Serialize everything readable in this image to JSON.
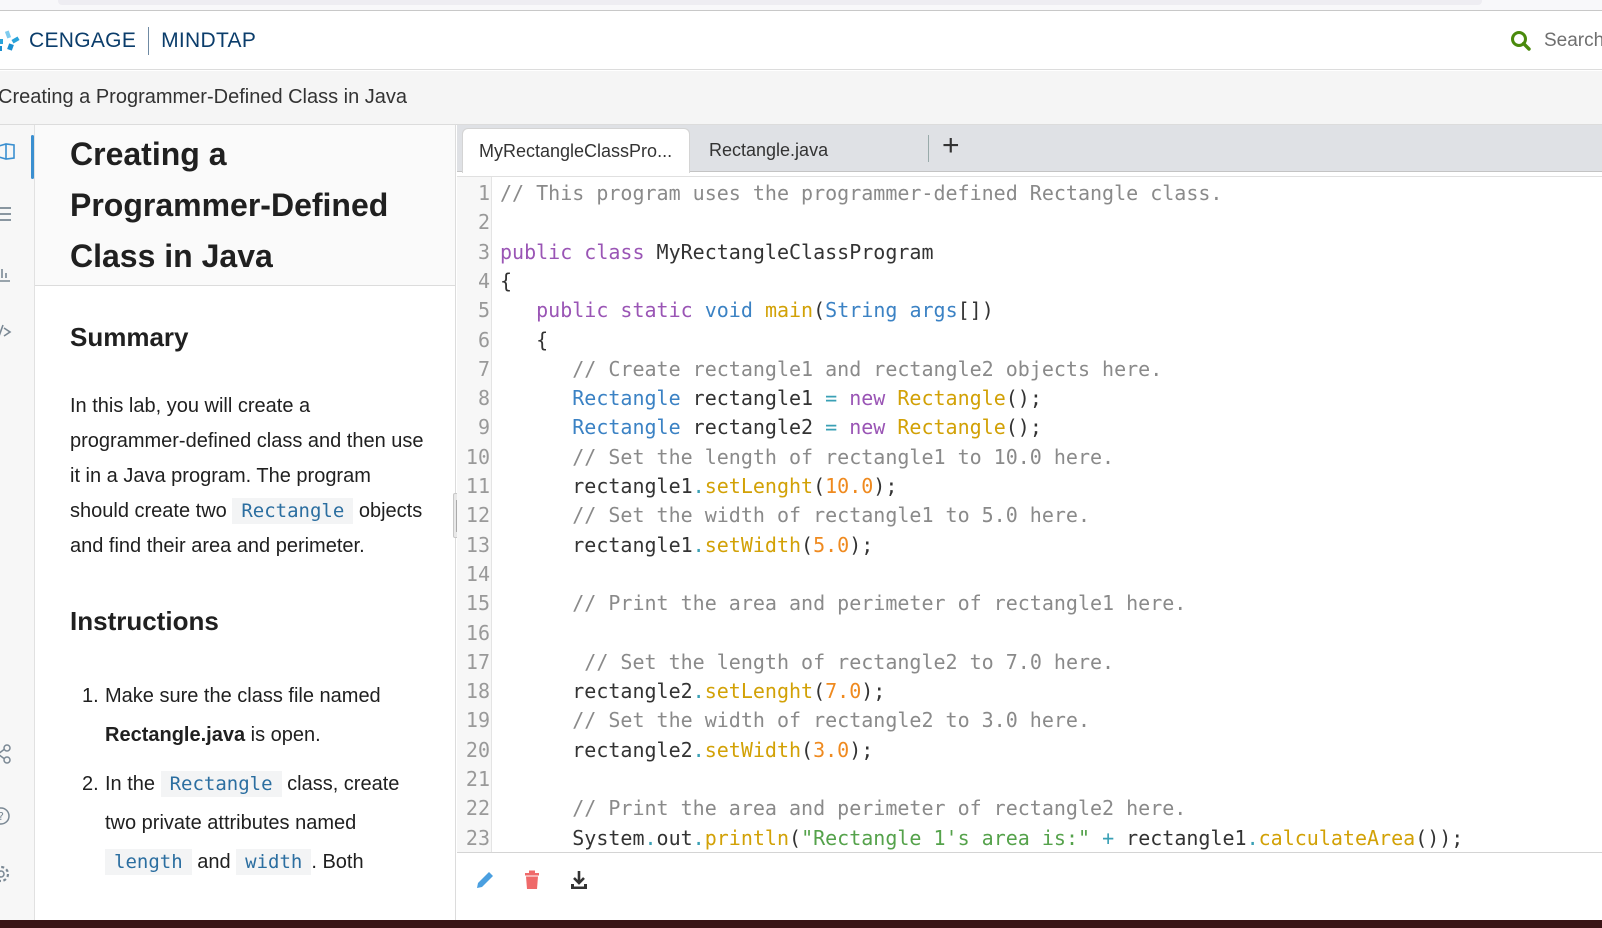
{
  "header": {
    "brand_primary": "CENGAGE",
    "brand_secondary": "MINDTAP",
    "search_label": "Search",
    "search_icon": "search-icon",
    "accent_color": "#4a8a0c"
  },
  "breadcrumb": {
    "title": "Creating a Programmer-Defined Class in Java"
  },
  "rail": {
    "items": [
      {
        "name": "book-icon",
        "active": true
      },
      {
        "name": "list-icon"
      },
      {
        "name": "chart-icon"
      },
      {
        "name": "code-icon"
      },
      {
        "name": "share-icon"
      },
      {
        "name": "help-icon"
      },
      {
        "name": "settings-icon"
      }
    ]
  },
  "lesson": {
    "title_lines": [
      "Creating a",
      "Programmer-Defined",
      "Class in Java"
    ],
    "summary_heading": "Summary",
    "summary_parts": {
      "p1": "In this lab, you will create a programmer-defined class and then use it in a Java program. The program should create two",
      "code": "Rectangle",
      "p2": "objects and find their area and perimeter."
    },
    "instructions_heading": "Instructions",
    "steps": [
      {
        "num": "1.",
        "pre": "Make sure the class file named",
        "bold": "Rectangle.java",
        "post": "is open."
      },
      {
        "num": "2.",
        "pre": "In the",
        "code1": "Rectangle",
        "mid": "class, create two private attributes named",
        "code2": "length",
        "and": "and",
        "code3": "width",
        "post": ". Both"
      }
    ]
  },
  "editor": {
    "tabs": [
      {
        "label": "MyRectangleClassPro...",
        "active": true
      },
      {
        "label": "Rectangle.java",
        "active": false
      }
    ],
    "add_tab_label": "+",
    "lines": [
      {
        "n": "1",
        "tokens": [
          [
            "c-comment",
            "// This program uses the programmer-defined Rectangle class."
          ]
        ]
      },
      {
        "n": "2",
        "tokens": []
      },
      {
        "n": "3",
        "tokens": [
          [
            "c-kw",
            "public"
          ],
          [
            "",
            " "
          ],
          [
            "c-kw",
            "class"
          ],
          [
            "",
            " MyRectangleClassProgram"
          ]
        ]
      },
      {
        "n": "4",
        "tokens": [
          [
            "",
            "{"
          ]
        ]
      },
      {
        "n": "5",
        "tokens": [
          [
            "",
            "   "
          ],
          [
            "c-kw",
            "public"
          ],
          [
            "",
            " "
          ],
          [
            "c-kw",
            "static"
          ],
          [
            "",
            " "
          ],
          [
            "c-type",
            "void"
          ],
          [
            "",
            " "
          ],
          [
            "c-fn",
            "main"
          ],
          [
            "",
            "("
          ],
          [
            "c-type",
            "String"
          ],
          [
            "",
            " "
          ],
          [
            "c-type",
            "args"
          ],
          [
            "",
            "[])"
          ]
        ]
      },
      {
        "n": "6",
        "tokens": [
          [
            "",
            "   {"
          ]
        ]
      },
      {
        "n": "7",
        "tokens": [
          [
            "",
            "      "
          ],
          [
            "c-comment",
            "// Create rectangle1 and rectangle2 objects here."
          ]
        ]
      },
      {
        "n": "8",
        "tokens": [
          [
            "",
            "      "
          ],
          [
            "c-type",
            "Rectangle"
          ],
          [
            "",
            " rectangle1 "
          ],
          [
            "c-op",
            "="
          ],
          [
            "",
            " "
          ],
          [
            "c-kw",
            "new"
          ],
          [
            "",
            " "
          ],
          [
            "c-fn",
            "Rectangle"
          ],
          [
            "",
            "();"
          ]
        ]
      },
      {
        "n": "9",
        "tokens": [
          [
            "",
            "      "
          ],
          [
            "c-type",
            "Rectangle"
          ],
          [
            "",
            " rectangle2 "
          ],
          [
            "c-op",
            "="
          ],
          [
            "",
            " "
          ],
          [
            "c-kw",
            "new"
          ],
          [
            "",
            " "
          ],
          [
            "c-fn",
            "Rectangle"
          ],
          [
            "",
            "();"
          ]
        ]
      },
      {
        "n": "10",
        "tokens": [
          [
            "",
            "      "
          ],
          [
            "c-comment",
            "// Set the length of rectangle1 to 10.0 here."
          ]
        ]
      },
      {
        "n": "11",
        "tokens": [
          [
            "",
            "      rectangle1"
          ],
          [
            "c-dot",
            "."
          ],
          [
            "c-fn",
            "setLenght"
          ],
          [
            "",
            "("
          ],
          [
            "c-num",
            "10.0"
          ],
          [
            "",
            ");"
          ]
        ]
      },
      {
        "n": "12",
        "tokens": [
          [
            "",
            "      "
          ],
          [
            "c-comment",
            "// Set the width of rectangle1 to 5.0 here."
          ]
        ]
      },
      {
        "n": "13",
        "tokens": [
          [
            "",
            "      rectangle1"
          ],
          [
            "c-dot",
            "."
          ],
          [
            "c-fn",
            "setWidth"
          ],
          [
            "",
            "("
          ],
          [
            "c-num",
            "5.0"
          ],
          [
            "",
            ");"
          ]
        ]
      },
      {
        "n": "14",
        "tokens": []
      },
      {
        "n": "15",
        "tokens": [
          [
            "",
            "      "
          ],
          [
            "c-comment",
            "// Print the area and perimeter of rectangle1 here."
          ]
        ]
      },
      {
        "n": "16",
        "tokens": []
      },
      {
        "n": "17",
        "tokens": [
          [
            "",
            "       "
          ],
          [
            "c-comment",
            "// Set the length of rectangle2 to 7.0 here."
          ]
        ]
      },
      {
        "n": "18",
        "tokens": [
          [
            "",
            "      rectangle2"
          ],
          [
            "c-dot",
            "."
          ],
          [
            "c-fn",
            "setLenght"
          ],
          [
            "",
            "("
          ],
          [
            "c-num",
            "7.0"
          ],
          [
            "",
            ");"
          ]
        ]
      },
      {
        "n": "19",
        "tokens": [
          [
            "",
            "      "
          ],
          [
            "c-comment",
            "// Set the width of rectangle2 to 3.0 here."
          ]
        ]
      },
      {
        "n": "20",
        "tokens": [
          [
            "",
            "      rectangle2"
          ],
          [
            "c-dot",
            "."
          ],
          [
            "c-fn",
            "setWidth"
          ],
          [
            "",
            "("
          ],
          [
            "c-num",
            "3.0"
          ],
          [
            "",
            ");"
          ]
        ]
      },
      {
        "n": "21",
        "tokens": []
      },
      {
        "n": "22",
        "tokens": [
          [
            "",
            "      "
          ],
          [
            "c-comment",
            "// Print the area and perimeter of rectangle2 here."
          ]
        ]
      },
      {
        "n": "23",
        "tokens": [
          [
            "",
            "      System"
          ],
          [
            "c-dot",
            "."
          ],
          [
            "",
            "out"
          ],
          [
            "c-dot",
            "."
          ],
          [
            "c-fn",
            "println"
          ],
          [
            "",
            "("
          ],
          [
            "c-str",
            "\"Rectangle 1's area is:\""
          ],
          [
            "",
            " "
          ],
          [
            "c-op",
            "+"
          ],
          [
            "",
            " rectangle1"
          ],
          [
            "c-dot",
            "."
          ],
          [
            "c-fn",
            "calculateArea"
          ],
          [
            "",
            "());"
          ]
        ]
      }
    ],
    "toolbar": [
      {
        "name": "edit-pencil-icon",
        "color": "#4a9fe0"
      },
      {
        "name": "delete-trash-icon",
        "color": "#ef6a6a"
      },
      {
        "name": "download-icon",
        "color": "#333333"
      }
    ]
  }
}
